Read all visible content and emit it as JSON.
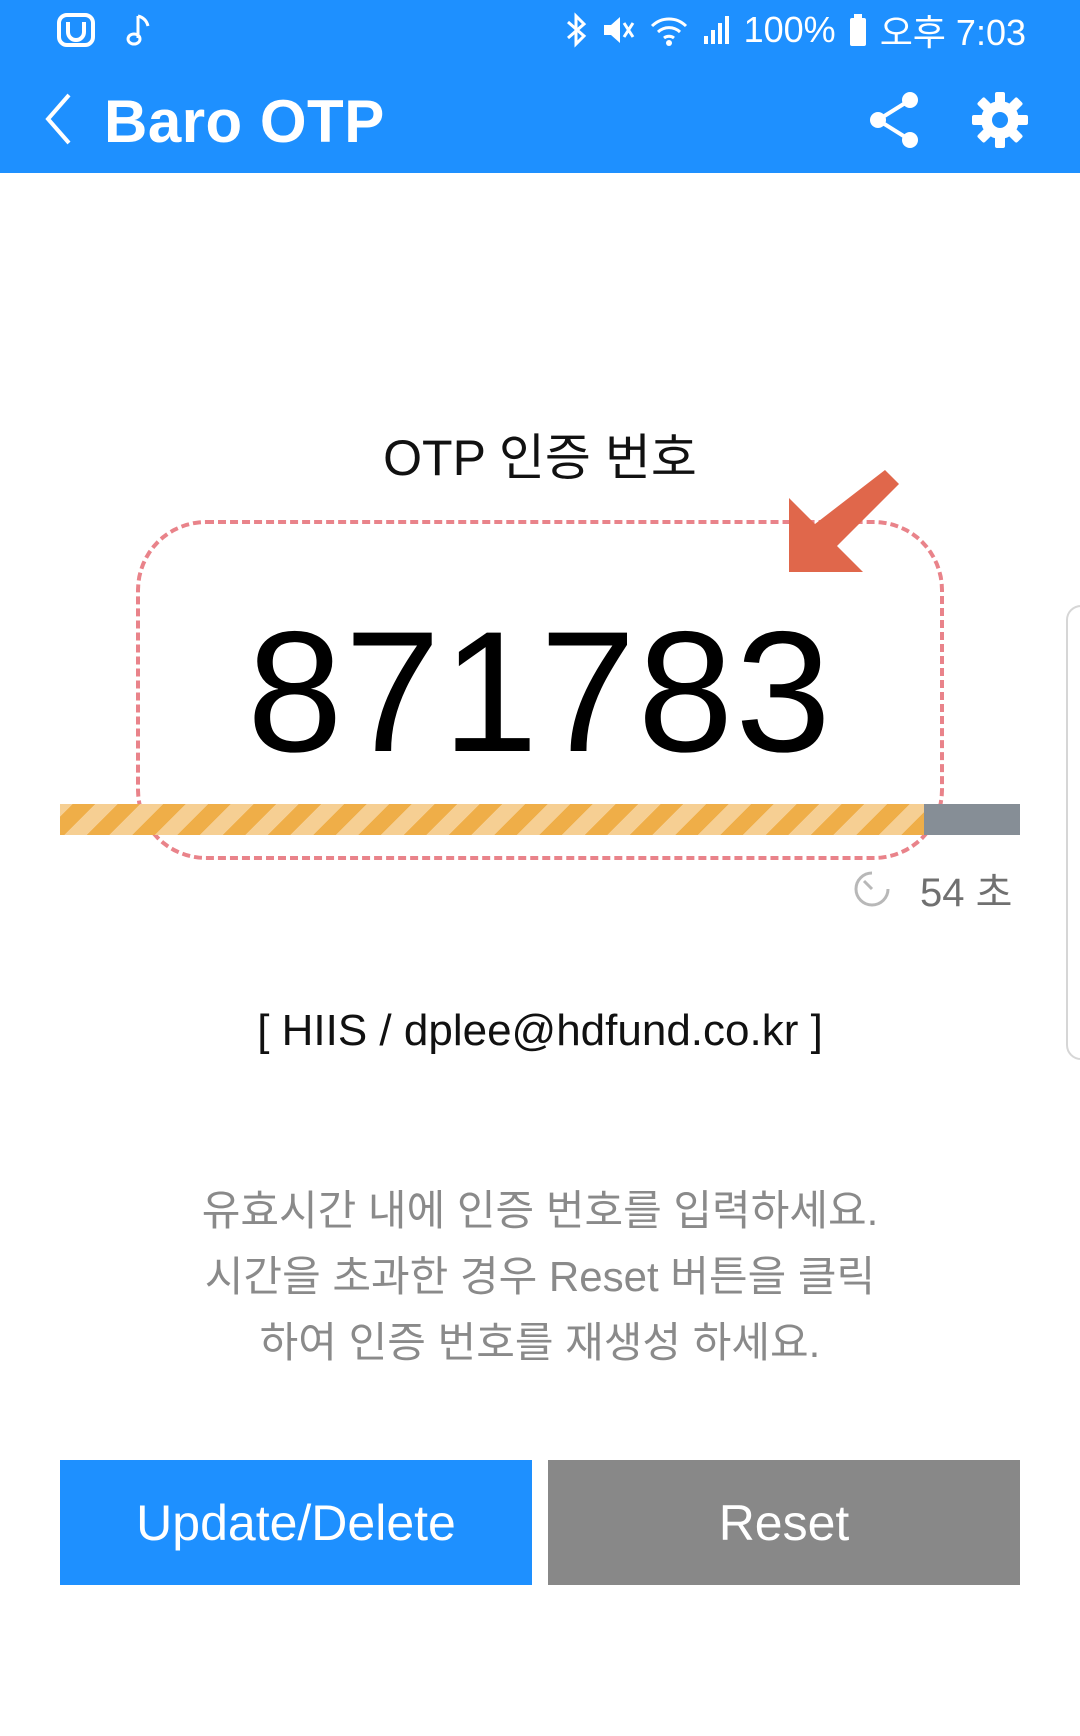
{
  "status_bar": {
    "battery": "100%",
    "time": "오후 7:03",
    "icons": [
      "app-notification-icon",
      "music-note-icon",
      "bluetooth-icon",
      "mute-icon",
      "wifi-icon",
      "signal-icon",
      "battery-icon"
    ]
  },
  "app_bar": {
    "title": "Baro OTP",
    "icons": [
      "back-icon",
      "share-icon",
      "gear-icon"
    ]
  },
  "otp": {
    "label": "OTP 인증 번호",
    "code": "871783",
    "progress_fraction": 0.9,
    "remaining_seconds": "54",
    "seconds_unit": "초",
    "remaining_text": "54 초"
  },
  "account": "[ HIIS / dplee@hdfund.co.kr ]",
  "instructions": [
    "유효시간 내에 인증 번호를 입력하세요.",
    "시간을 초과한 경우 Reset 버튼을 클릭",
    "하여 인증 번호를 재생성 하세요."
  ],
  "buttons": {
    "update_delete": "Update/Delete",
    "reset": "Reset"
  },
  "colors": {
    "primary": "#1e90ff",
    "reset_button": "#888888",
    "progress_fill": "#efae48",
    "progress_track": "#868e96",
    "highlight_border": "#e9838a",
    "arrow": "#e0674b"
  }
}
